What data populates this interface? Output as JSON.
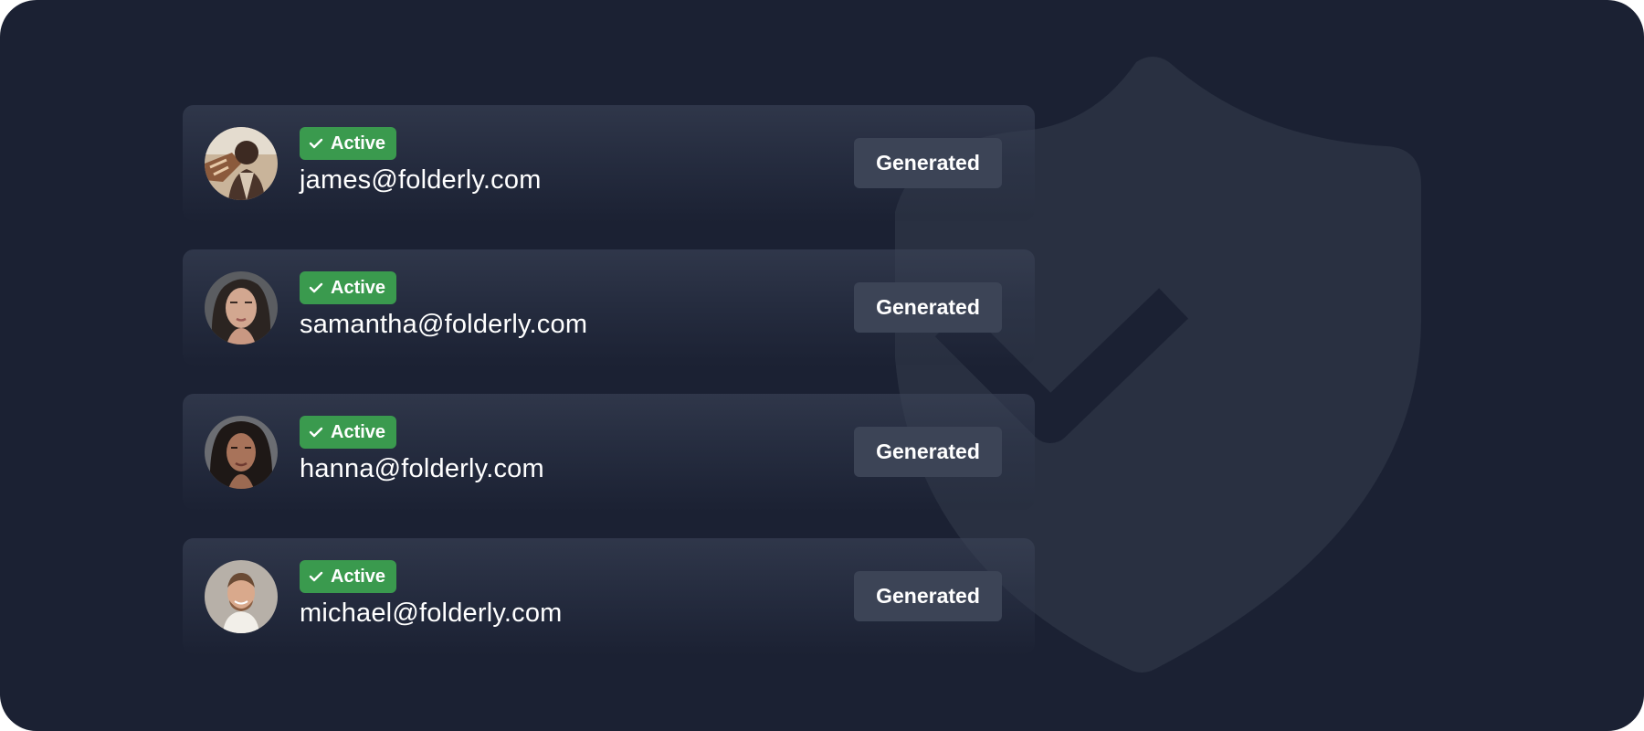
{
  "colors": {
    "background": "#1b2133",
    "active_badge": "#3a9a4e",
    "generated_button": "#3c4456",
    "shield": "#2a3142",
    "shield_check": "#1b2133"
  },
  "icons": {
    "badge_icon": "checkmark-icon",
    "background_icon": "shield-check-icon"
  },
  "users": [
    {
      "status": "Active",
      "email": "james@folderly.com",
      "action": "Generated"
    },
    {
      "status": "Active",
      "email": "samantha@folderly.com",
      "action": "Generated"
    },
    {
      "status": "Active",
      "email": "hanna@folderly.com",
      "action": "Generated"
    },
    {
      "status": "Active",
      "email": "michael@folderly.com",
      "action": "Generated"
    }
  ]
}
